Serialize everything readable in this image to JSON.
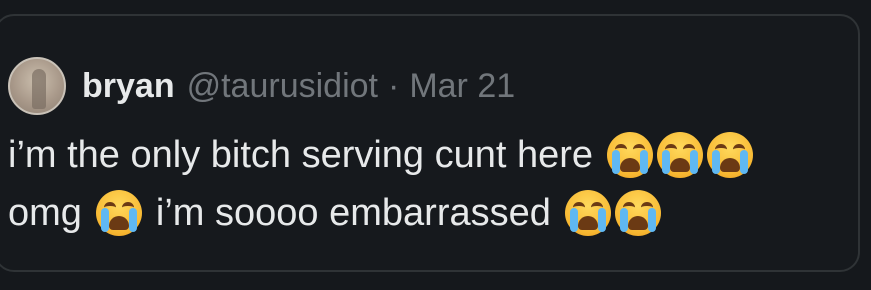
{
  "tweet": {
    "author_name": "bryan",
    "handle": "@taurusidiot",
    "separator": "·",
    "date": "Mar 21",
    "line1_text": "i’m the only bitch serving cunt here",
    "line2_text_a": "omg",
    "line2_text_b": "i’m soooo embarrassed",
    "emoji_name": "loudly-crying-face"
  },
  "colors": {
    "background": "#15181c",
    "text": "#e7e9ea",
    "muted": "#71767b",
    "border": "#2f3336"
  }
}
